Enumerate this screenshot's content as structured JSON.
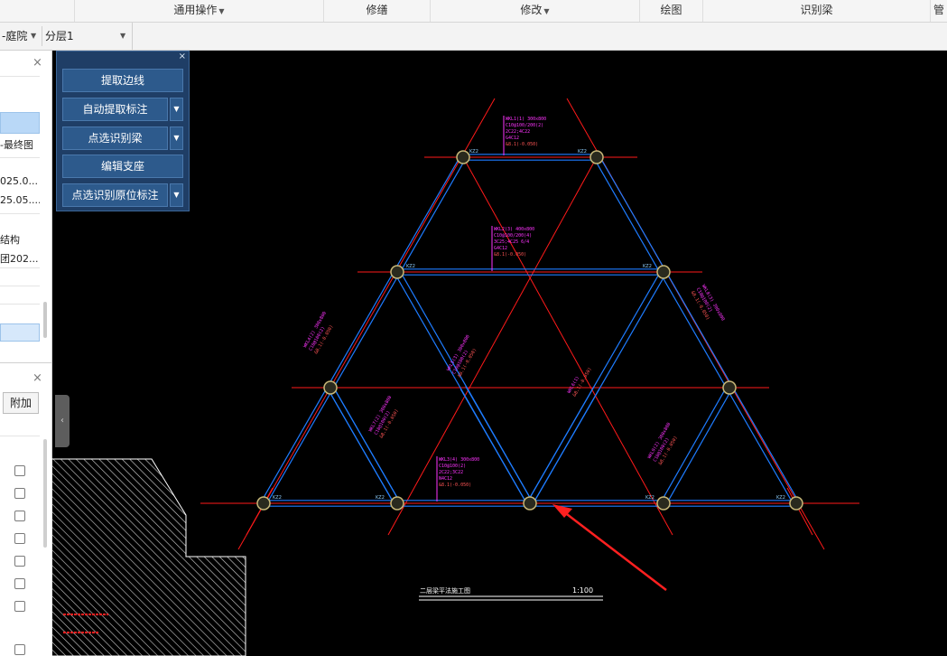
{
  "ribbon": {
    "groups": [
      {
        "label": "通用操作",
        "dropdown": true
      },
      {
        "label": "修缮",
        "dropdown": false
      },
      {
        "label": "修改",
        "dropdown": true
      },
      {
        "label": "绘图",
        "dropdown": false
      },
      {
        "label": "识别梁",
        "dropdown": false
      },
      {
        "label": "管",
        "dropdown": false
      }
    ]
  },
  "toolbar": {
    "floor_select": "-庭院",
    "layer_select": "分层1"
  },
  "left_panel": {
    "item_final": "-最终图",
    "date1": "025.0...",
    "date2": "25.05....",
    "item_structure": "结构",
    "item_202": "团202...",
    "attach_button": "附加"
  },
  "float_panel": {
    "close": "×",
    "buttons": [
      {
        "label": "提取边线",
        "has_dropdown": false
      },
      {
        "label": "自动提取标注",
        "has_dropdown": true
      },
      {
        "label": "点选识别梁",
        "has_dropdown": true
      },
      {
        "label": "编辑支座",
        "has_dropdown": false
      },
      {
        "label": "点选识别原位标注",
        "has_dropdown": true
      }
    ]
  },
  "drawing": {
    "title": "二层梁平法施工图",
    "scale": "1:100",
    "colors": {
      "background": "#000000",
      "axis": "#ff1a1a",
      "beam": "#1e7cff",
      "annotation": "#ff33ff",
      "column": "#c8b878"
    }
  }
}
